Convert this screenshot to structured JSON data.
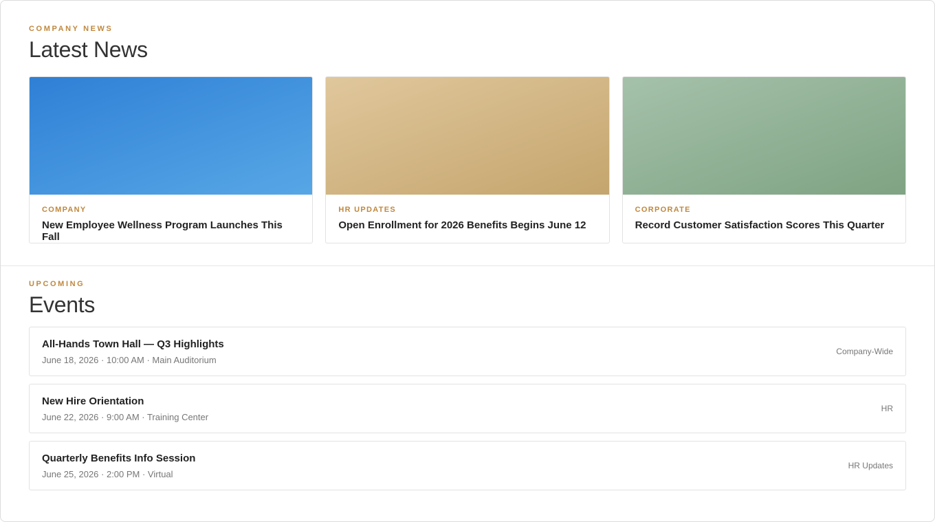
{
  "news": {
    "eyebrow": "COMPANY NEWS",
    "title": "Latest News",
    "cards": [
      {
        "category": "COMPANY",
        "title": "New Employee Wellness Program Launches This Fall",
        "gradient_from": "#2f80d6",
        "gradient_to": "#57a7e6"
      },
      {
        "category": "HR UPDATES",
        "title": "Open Enrollment for 2026 Benefits Begins June 12",
        "gradient_from": "#e0c79c",
        "gradient_to": "#c4a56d"
      },
      {
        "category": "CORPORATE",
        "title": "Record Customer Satisfaction Scores This Quarter",
        "gradient_from": "#a5c1aa",
        "gradient_to": "#7fa383"
      }
    ]
  },
  "events": {
    "eyebrow": "UPCOMING",
    "title": "Events",
    "items": [
      {
        "title": "All-Hands Town Hall — Q3 Highlights",
        "meta": "June 18, 2026 · 10:00 AM · Main Auditorium",
        "tag": "Company-Wide"
      },
      {
        "title": "New Hire Orientation",
        "meta": "June 22, 2026 · 9:00 AM · Training Center",
        "tag": "HR"
      },
      {
        "title": "Quarterly Benefits Info Session",
        "meta": "June 25, 2026 · 2:00 PM · Virtual",
        "tag": "HR Updates"
      }
    ]
  },
  "colors": {
    "accent": "#c0873c"
  }
}
